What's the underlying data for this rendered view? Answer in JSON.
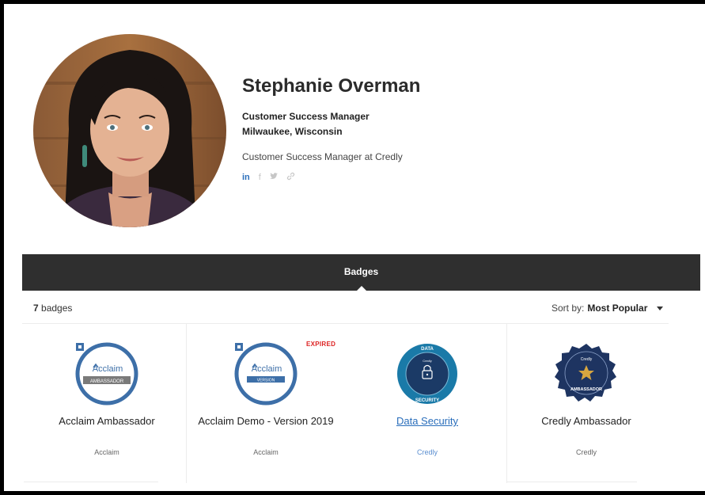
{
  "profile": {
    "name": "Stephanie Overman",
    "title": "Customer Success Manager",
    "location": "Milwaukee, Wisconsin",
    "bio": "Customer Success Manager at Credly",
    "social": {
      "linkedin": "in",
      "facebook": "f",
      "twitter": "𝕥",
      "link": "🔗"
    }
  },
  "tabs": {
    "badges_label": "Badges"
  },
  "summary": {
    "count": "7",
    "count_suffix": " badges"
  },
  "sort": {
    "label": "Sort by:",
    "value": "Most Popular"
  },
  "badges": [
    {
      "name": "Acclaim Ambassador",
      "issuer": "Acclaim",
      "badge_text": "Acclaim",
      "ribbon": "AMBASSADOR"
    },
    {
      "name": "Acclaim Demo - Version 2019",
      "issuer": "Acclaim",
      "badge_text": "Acclaim",
      "ribbon": "VERSION",
      "status": "EXPIRED"
    },
    {
      "name": "Data Security",
      "issuer": "Credly",
      "badge_top": "DATA",
      "badge_bottom": "SECURITY",
      "brand": "Credly"
    },
    {
      "name": "Credly Ambassador",
      "issuer": "Credly",
      "badge_top": "Credly",
      "badge_bottom": "AMBASSADOR"
    }
  ],
  "colors": {
    "tabbar": "#2f2f2f",
    "link": "#2a6ebb",
    "expired": "#dd2222",
    "badge_blue": "#3d6fa8",
    "navy": "#1e3461"
  }
}
